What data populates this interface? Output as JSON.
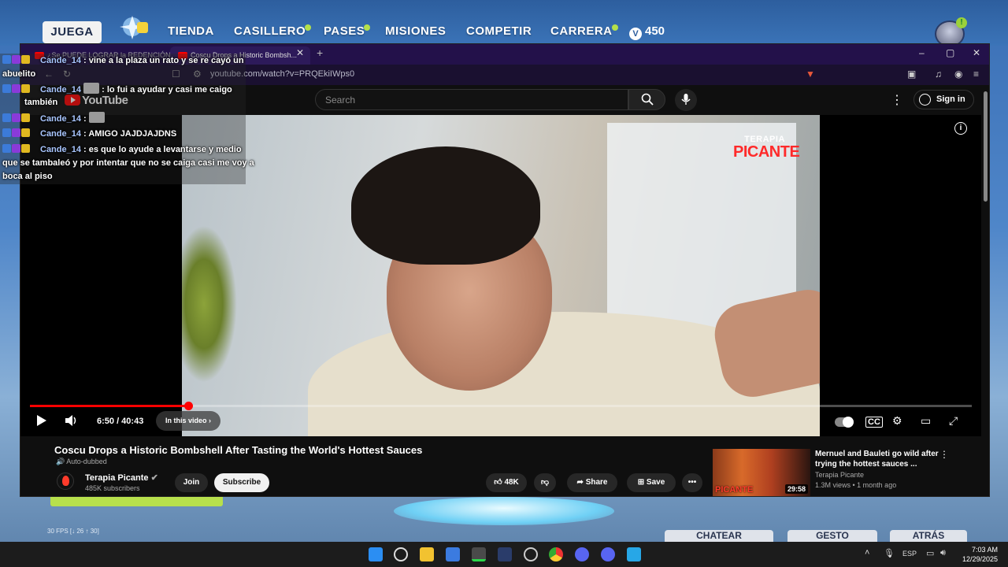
{
  "game": {
    "tabs": [
      {
        "label": "JUEGA",
        "active": true
      },
      {
        "label": "TIENDA"
      },
      {
        "label": "CASILLERO",
        "dot": true
      },
      {
        "label": "PASES",
        "dot": true
      },
      {
        "label": "MISIONES"
      },
      {
        "label": "COMPETIR"
      },
      {
        "label": "CARRERA",
        "dot": true
      }
    ],
    "vbucks": "450",
    "fps": "30 FPS [↓ 26 ↑ 30]",
    "bottom_buttons": [
      "CHATEAR",
      "GESTO",
      "ATRÁS"
    ]
  },
  "browser": {
    "tabs": [
      {
        "title": "¿Se PUEDE LOGRAR la REDENCIÓN? ..."
      },
      {
        "title": "Coscu Drops a Historic Bombsh...",
        "active": true
      }
    ],
    "url": "youtube.com/watch?v=PRQEkiIWps0",
    "window_controls": {
      "minimize": "–",
      "maximize": "▢",
      "close": "✕"
    }
  },
  "youtube": {
    "logo": "YouTube",
    "search_placeholder": "Search",
    "signin_label": "Sign in",
    "video": {
      "brand_top": "TERAPIA",
      "brand_bottom": "PICANTE",
      "current_time": "6:50 / 40:43",
      "progress": 0.168,
      "chapter_label": "In this video",
      "title": "Coscu Drops a Historic Bombshell After Tasting the World's Hottest Sauces",
      "auto_dubbed": "Auto-dubbed"
    },
    "channel": {
      "name": "Terapia Picante",
      "subscribers": "485K subscribers",
      "join_label": "Join",
      "subscribe_label": "Subscribe"
    },
    "actions": {
      "likes": "48K",
      "share": "Share",
      "save": "Save"
    },
    "recommendation": {
      "title": "Mernuel and Bauleti go wild after trying the hottest sauces ...",
      "channel": "Terapia Picante",
      "meta": "1.3M views • 1 month ago",
      "duration": "29:58",
      "thumb_label": "PICANTE"
    }
  },
  "chat": {
    "messages": [
      {
        "user": "Cande_14",
        "text": ": vine a la plaza un rato y se re cayó un",
        "cont": "abuelito"
      },
      {
        "user": "Cande_14",
        "text": ": lo fui a ayudar y casi me caigo",
        "cont": "también"
      },
      {
        "user": "Cande_14",
        "text": ":"
      },
      {
        "user": "Cande_14",
        "text": ": AMIGO JAJDJAJDNS"
      },
      {
        "user": "Cande_14",
        "text": ": es que lo ayude a levantarse y medio",
        "cont": "que se tambaleó y por intentar que no se caiga casi me voy a",
        "cont2": "boca al piso"
      }
    ]
  },
  "taskbar": {
    "lang": "ESP",
    "time": "7:03 AM",
    "date": "12/29/2025"
  },
  "colors": {
    "youtube_red": "#ff0000",
    "brand_red": "#ff2a2a",
    "chat_user": "#a9c6ff",
    "game_green": "#b7e04c"
  }
}
